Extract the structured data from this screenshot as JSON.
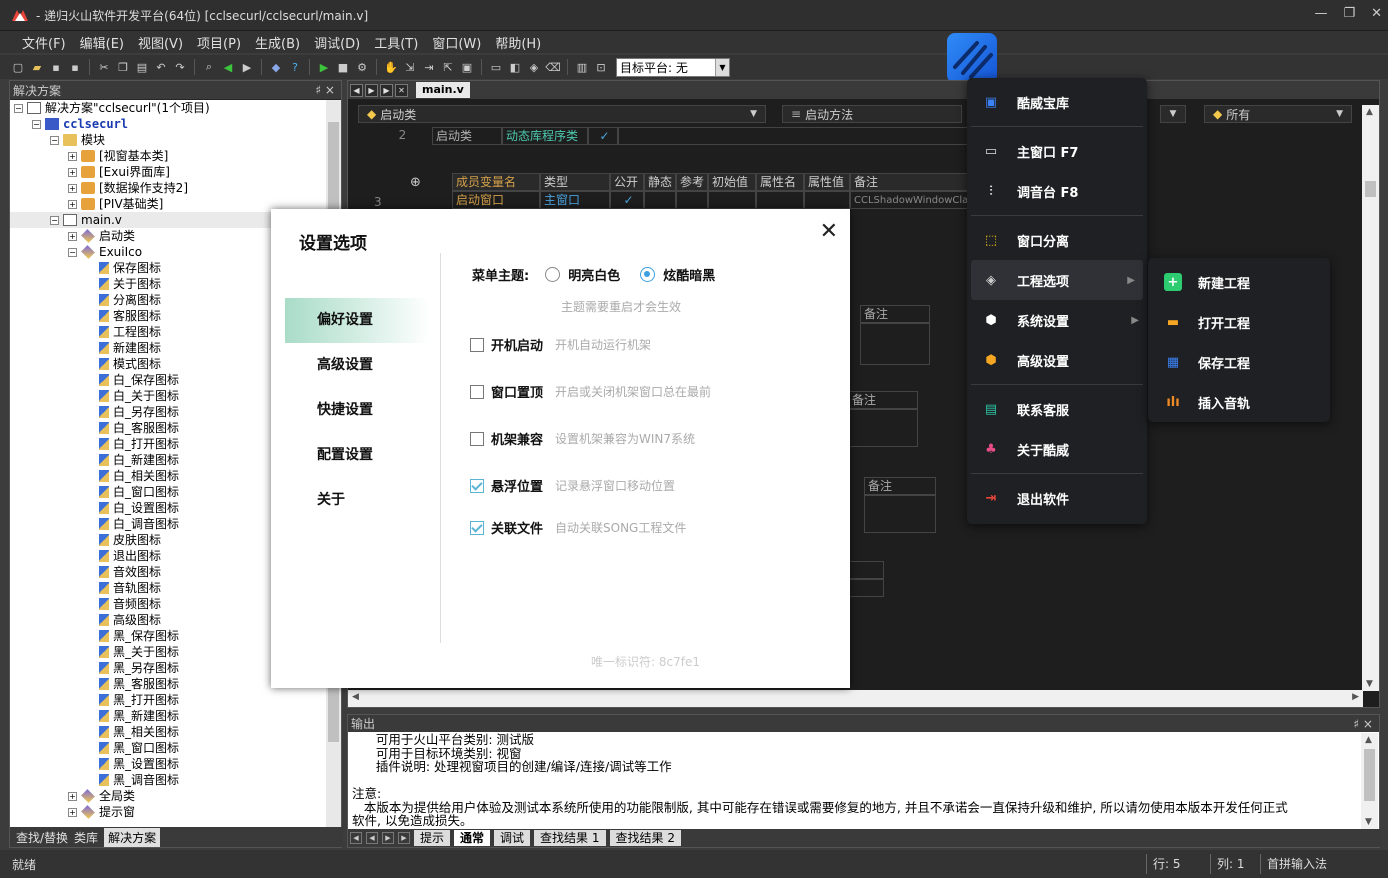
{
  "window": {
    "title": "- 递归火山软件开发平台(64位) [cclsecurl/cclsecurl/main.v]",
    "controls": [
      "—",
      "❐",
      "✕"
    ]
  },
  "menu": [
    "文件(F)",
    "编辑(E)",
    "视图(V)",
    "项目(P)",
    "生成(B)",
    "调试(D)",
    "工具(T)",
    "窗口(W)",
    "帮助(H)"
  ],
  "toolbar": {
    "platform_value": "目标平台: 无"
  },
  "solution_panel": {
    "title": "解决方案",
    "pin": "♯ ×",
    "tree": [
      {
        "indent": 0,
        "exp": "-",
        "icon": "page",
        "label": "解决方案\"cclsecurl\"(1个项目)"
      },
      {
        "indent": 1,
        "exp": "-",
        "icon": "proj",
        "label": "cclsecurl",
        "blue": true
      },
      {
        "indent": 2,
        "exp": "-",
        "icon": "folder",
        "label": "模块"
      },
      {
        "indent": 3,
        "exp": "+",
        "icon": "cls",
        "label": "[视窗基本类]"
      },
      {
        "indent": 3,
        "exp": "+",
        "icon": "cls",
        "label": "[Exui界面库]"
      },
      {
        "indent": 3,
        "exp": "+",
        "icon": "cls",
        "label": "[数据操作支持2]"
      },
      {
        "indent": 3,
        "exp": "+",
        "icon": "cls",
        "label": "[PIV基础类]"
      },
      {
        "indent": 2,
        "exp": "-",
        "icon": "page",
        "label": "main.v",
        "sel": true
      },
      {
        "indent": 3,
        "exp": "+",
        "icon": "diamond",
        "label": "启动类"
      },
      {
        "indent": 3,
        "exp": "-",
        "icon": "diamond",
        "label": "ExuiIco"
      },
      {
        "indent": 4,
        "icon": "mem",
        "label": "保存图标"
      },
      {
        "indent": 4,
        "icon": "mem",
        "label": "关于图标"
      },
      {
        "indent": 4,
        "icon": "mem",
        "label": "分离图标"
      },
      {
        "indent": 4,
        "icon": "mem",
        "label": "客服图标"
      },
      {
        "indent": 4,
        "icon": "mem",
        "label": "工程图标"
      },
      {
        "indent": 4,
        "icon": "mem",
        "label": "新建图标"
      },
      {
        "indent": 4,
        "icon": "mem",
        "label": "模式图标"
      },
      {
        "indent": 4,
        "icon": "mem",
        "label": "白_保存图标"
      },
      {
        "indent": 4,
        "icon": "mem",
        "label": "白_关于图标"
      },
      {
        "indent": 4,
        "icon": "mem",
        "label": "白_另存图标"
      },
      {
        "indent": 4,
        "icon": "mem",
        "label": "白_客服图标"
      },
      {
        "indent": 4,
        "icon": "mem",
        "label": "白_打开图标"
      },
      {
        "indent": 4,
        "icon": "mem",
        "label": "白_新建图标"
      },
      {
        "indent": 4,
        "icon": "mem",
        "label": "白_相关图标"
      },
      {
        "indent": 4,
        "icon": "mem",
        "label": "白_窗口图标"
      },
      {
        "indent": 4,
        "icon": "mem",
        "label": "白_设置图标"
      },
      {
        "indent": 4,
        "icon": "mem",
        "label": "白_调音图标"
      },
      {
        "indent": 4,
        "icon": "mem",
        "label": "皮肤图标"
      },
      {
        "indent": 4,
        "icon": "mem",
        "label": "退出图标"
      },
      {
        "indent": 4,
        "icon": "mem",
        "label": "音效图标"
      },
      {
        "indent": 4,
        "icon": "mem",
        "label": "音轨图标"
      },
      {
        "indent": 4,
        "icon": "mem",
        "label": "音频图标"
      },
      {
        "indent": 4,
        "icon": "mem",
        "label": "高级图标"
      },
      {
        "indent": 4,
        "icon": "mem",
        "label": "黑_保存图标"
      },
      {
        "indent": 4,
        "icon": "mem",
        "label": "黑_关于图标"
      },
      {
        "indent": 4,
        "icon": "mem",
        "label": "黑_另存图标"
      },
      {
        "indent": 4,
        "icon": "mem",
        "label": "黑_客服图标"
      },
      {
        "indent": 4,
        "icon": "mem",
        "label": "黑_打开图标"
      },
      {
        "indent": 4,
        "icon": "mem",
        "label": "黑_新建图标"
      },
      {
        "indent": 4,
        "icon": "mem",
        "label": "黑_相关图标"
      },
      {
        "indent": 4,
        "icon": "mem",
        "label": "黑_窗口图标"
      },
      {
        "indent": 4,
        "icon": "mem",
        "label": "黑_设置图标"
      },
      {
        "indent": 4,
        "icon": "mem",
        "label": "黑_调音图标"
      },
      {
        "indent": 3,
        "exp": "+",
        "icon": "diamond",
        "label": "全局类"
      },
      {
        "indent": 3,
        "exp": "+",
        "icon": "diamond",
        "label": "提示窗"
      }
    ],
    "tabs": [
      {
        "label": "查找/替换"
      },
      {
        "label": "类库"
      },
      {
        "label": "解决方案",
        "active": true
      }
    ]
  },
  "editor": {
    "tab": "main.v",
    "combo_class": "启动类",
    "combo_method": "启动方法",
    "combo_all": "所有",
    "row2": {
      "num": "2",
      "c1": "启动类",
      "c2": "动态库程序类",
      "c3": "✓"
    },
    "member_headers": [
      "成员变量名",
      "类型",
      "公开",
      "静态",
      "参考",
      "初始值",
      "属性名",
      "属性值",
      "备注"
    ],
    "row3": {
      "num": "3",
      "name": "启动窗口",
      "type": "主窗口",
      "public": "✓",
      "note": "CCLShadowWindowClas"
    },
    "bg_note": "备注"
  },
  "output": {
    "title": "输出",
    "lines": [
      "      可用于火山平台类别: 测试版",
      "      可用于目标环境类别: 视窗",
      "      插件说明: 处理视窗项目的创建/编译/连接/调试等工作",
      "",
      "注意:",
      "   本版本为提供给用户体验及测试本系统所使用的功能限制版, 其中可能存在错误或需要修复的地方, 并且不承诺会一直保持升级和维护, 所以请勿使用本版本开发任何正式",
      "软件, 以免造成损失。"
    ],
    "tabs": [
      {
        "label": "提示"
      },
      {
        "label": "通常",
        "active": true
      },
      {
        "label": "调试"
      },
      {
        "label": "查找结果 1"
      },
      {
        "label": "查找结果 2"
      }
    ]
  },
  "status": {
    "ready": "就绪",
    "row": "行: 5",
    "col": "列: 1",
    "ime": "首拼输入法"
  },
  "dialog": {
    "title": "设置选项",
    "close": "✕",
    "nav": [
      {
        "label": "偏好设置",
        "active": true
      },
      {
        "label": "高级设置"
      },
      {
        "label": "快捷设置"
      },
      {
        "label": "配置设置"
      },
      {
        "label": "关于"
      }
    ],
    "theme_label": "菜单主题:",
    "theme_light": "明亮白色",
    "theme_dark": "炫酷暗黑",
    "theme_hint": "主题需要重启才会生效",
    "options": [
      {
        "label": "开机启动",
        "hint": "开机自动运行机架",
        "checked": false
      },
      {
        "label": "窗口置顶",
        "hint": "开启或关闭机架窗口总在最前",
        "checked": false
      },
      {
        "label": "机架兼容",
        "hint": "设置机架兼容为WIN7系统",
        "checked": false
      },
      {
        "label": "悬浮位置",
        "hint": "记录悬浮窗口移动位置",
        "checked": true
      },
      {
        "label": "关联文件",
        "hint": "自动关联SONG工程文件",
        "checked": true
      }
    ],
    "uid": "唯一标识符: 8c7fe1"
  },
  "popup_menu": {
    "items": [
      {
        "label": "酷威宝库",
        "icon": "▣",
        "color": "#3b82f6"
      },
      {
        "sep": true
      },
      {
        "label": "主窗口 F7",
        "icon": "▭",
        "color": "#ddd"
      },
      {
        "label": "调音台 F8",
        "icon": "⫶",
        "color": "#ddd"
      },
      {
        "sep": true
      },
      {
        "label": "窗口分离",
        "icon": "⬚",
        "color": "#f5c518"
      },
      {
        "label": "工程选项",
        "icon": "◈",
        "color": "#ccc",
        "arrow": "▶",
        "hl": true
      },
      {
        "label": "系统设置",
        "icon": "⬢",
        "color": "#fff",
        "arrow": "▶"
      },
      {
        "label": "高级设置",
        "icon": "⬢",
        "color": "#f5a623"
      },
      {
        "sep": true
      },
      {
        "label": "联系客服",
        "icon": "▤",
        "color": "#2ec4a5"
      },
      {
        "label": "关于酷威",
        "icon": "♣",
        "color": "#e84d8a"
      },
      {
        "sep": true
      },
      {
        "label": "退出软件",
        "icon": "⇥",
        "color": "#e8453c"
      }
    ]
  },
  "submenu": {
    "items": [
      {
        "label": "新建工程",
        "icon": "+",
        "color": "#2ecc71"
      },
      {
        "label": "打开工程",
        "icon": "▬",
        "color": "#f5a623"
      },
      {
        "label": "保存工程",
        "icon": "▦",
        "color": "#3b82f6"
      },
      {
        "label": "插入音轨",
        "icon": "ılı",
        "color": "#f08a24"
      }
    ]
  }
}
